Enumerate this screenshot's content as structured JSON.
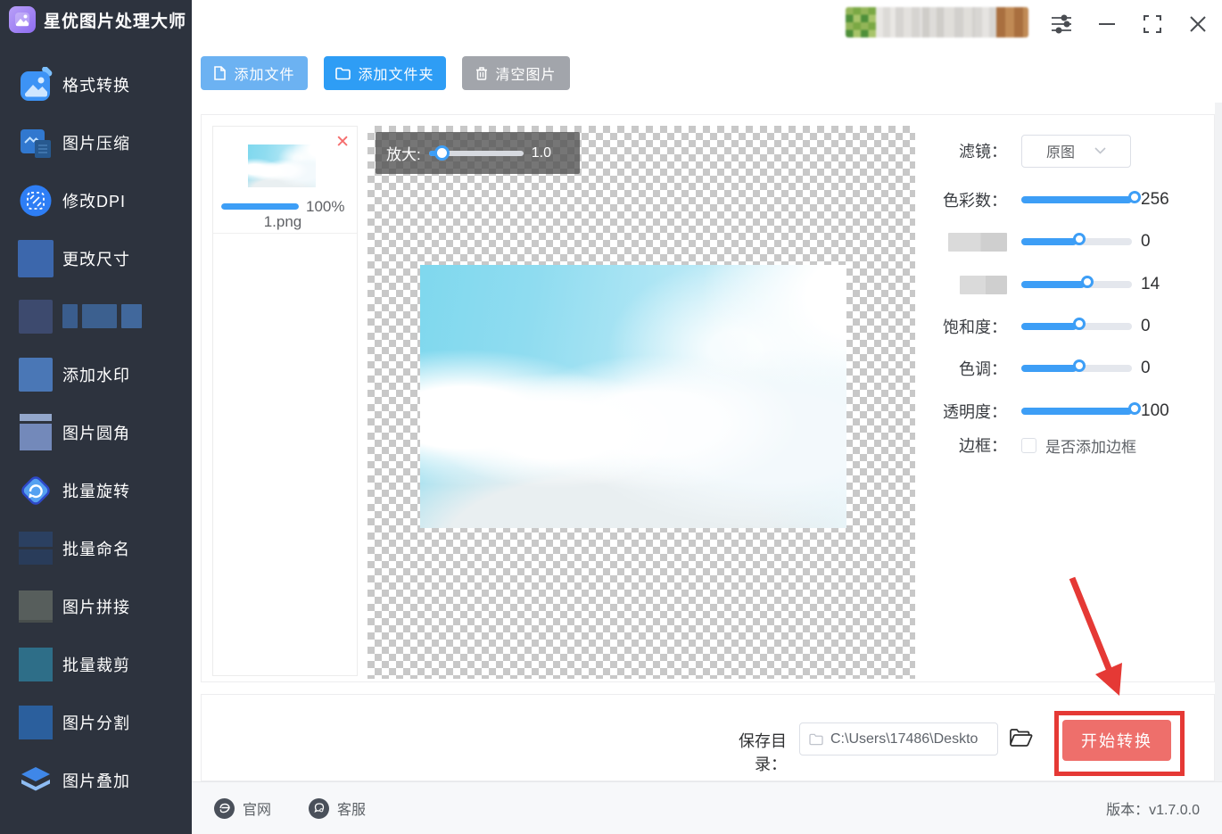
{
  "app": {
    "title": "星优图片处理大师"
  },
  "sidebar": {
    "items": [
      {
        "label": "格式转换"
      },
      {
        "label": "图片压缩"
      },
      {
        "label": "修改DPI"
      },
      {
        "label": "更改尺寸"
      },
      {
        "label": ""
      },
      {
        "label": "添加水印"
      },
      {
        "label": "图片圆角"
      },
      {
        "label": "批量旋转"
      },
      {
        "label": "批量命名"
      },
      {
        "label": "图片拼接"
      },
      {
        "label": "批量裁剪"
      },
      {
        "label": "图片分割"
      },
      {
        "label": "图片叠加"
      }
    ]
  },
  "toolbar": {
    "add_file_label": "添加文件",
    "add_folder_label": "添加文件夹",
    "clear_images_label": "清空图片"
  },
  "file_list": {
    "file": {
      "name": "1.png",
      "progress_label": "100%",
      "progress_pct": 100
    }
  },
  "preview": {
    "zoom_label": "放大:",
    "zoom_value": "1.0",
    "zoom_pct": 13
  },
  "filter_panel": {
    "filter_label": "滤镜：",
    "filter_selected": "原图",
    "sliders": [
      {
        "label": "色彩数：",
        "value": "256",
        "pct": 100
      },
      {
        "label": "",
        "value": "0",
        "pct": 50
      },
      {
        "label": "",
        "value": "14",
        "pct": 57
      },
      {
        "label": "饱和度：",
        "value": "0",
        "pct": 50
      },
      {
        "label": "色调：",
        "value": "0",
        "pct": 50
      },
      {
        "label": "透明度：",
        "value": "100",
        "pct": 100
      }
    ],
    "border_label": "边框：",
    "border_checkbox_text": "是否添加边框",
    "border_checked": false
  },
  "bottom_bar": {
    "save_dir_label": "保存目录：",
    "save_dir_value": "C:\\Users\\17486\\Deskto",
    "start_button_label": "开始转换"
  },
  "footer": {
    "website_label": "官网",
    "support_label": "客服",
    "version_label": "版本：v1.7.0.0"
  },
  "colors": {
    "accent_blue": "#3d9ef6",
    "button_light_blue": "#6cb2f2",
    "button_blue": "#2e9df5",
    "button_gray": "#a2a5ab",
    "start_button_red": "#ee6f6b",
    "annotation_red": "#e53935",
    "sidebar_bg": "#2d333e"
  }
}
